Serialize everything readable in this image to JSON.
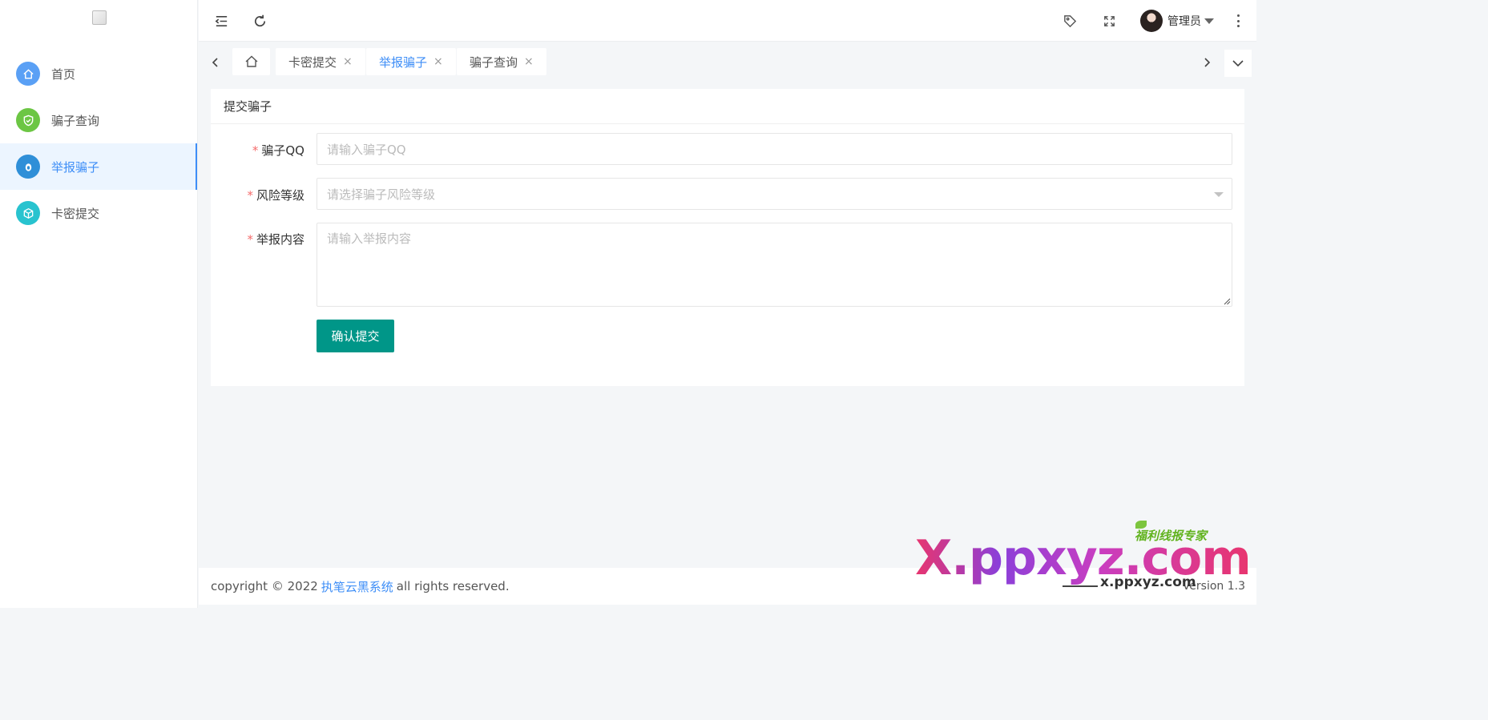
{
  "sidebar": {
    "items": [
      {
        "label": "首页",
        "icon": "home-icon",
        "color": "#5aa0f5"
      },
      {
        "label": "骗子查询",
        "icon": "shield-check-icon",
        "color": "#6cc644"
      },
      {
        "label": "举报骗子",
        "icon": "report-icon",
        "color": "#2f8fd8"
      },
      {
        "label": "卡密提交",
        "icon": "cube-icon",
        "color": "#28c3cf"
      }
    ],
    "active_index": 2
  },
  "header": {
    "user_name": "管理员"
  },
  "tabs": [
    {
      "label": "卡密提交",
      "close": "×"
    },
    {
      "label": "举报骗子",
      "close": "×"
    },
    {
      "label": "骗子查询",
      "close": "×"
    }
  ],
  "form": {
    "title": "提交骗子",
    "fields": [
      {
        "label": "骗子QQ",
        "placeholder": "请输入骗子QQ"
      },
      {
        "label": "风险等级",
        "placeholder": "请选择骗子风险等级"
      },
      {
        "label": "举报内容",
        "placeholder": "请输入举报内容"
      }
    ],
    "required_mark": "*",
    "submit_label": "确认提交"
  },
  "footer": {
    "prefix": "copyright © 2022",
    "link": "执笔云黑系统",
    "suffix": "all rights reserved.",
    "version": "Version 1.3"
  },
  "watermark": {
    "sub": "福利线报专家",
    "main": "X.ppxyz.com",
    "url": "x.ppxyz.com"
  },
  "colors": {
    "primary": "#3e8ef7",
    "submit": "#009688",
    "required": "#f56c6c"
  }
}
